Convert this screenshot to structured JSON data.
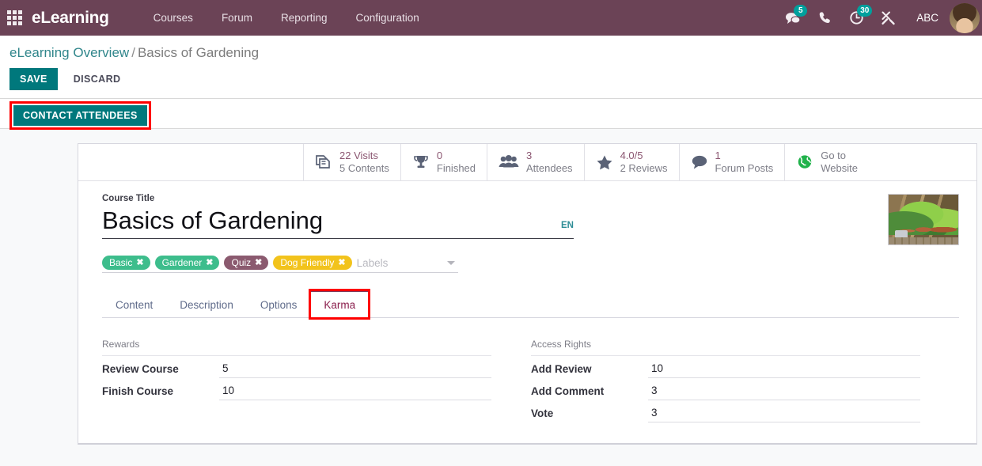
{
  "topbar": {
    "apps_icon": "apps-grid-icon",
    "brand": "eLearning",
    "menu": [
      {
        "label": "Courses"
      },
      {
        "label": "Forum"
      },
      {
        "label": "Reporting"
      },
      {
        "label": "Configuration"
      }
    ],
    "systray": [
      {
        "icon": "messages-icon",
        "badge": "5"
      },
      {
        "icon": "phone-icon",
        "badge": ""
      },
      {
        "icon": "activities-clock-icon",
        "badge": "30"
      },
      {
        "icon": "tools-icon",
        "badge": ""
      }
    ],
    "user_name": "ABC",
    "avatar": "user-avatar"
  },
  "breadcrumb": {
    "root": "eLearning Overview",
    "separator": "/",
    "current": "Basics of Gardening"
  },
  "actions": {
    "save_label": "SAVE",
    "discard_label": "DISCARD",
    "contact_attendees_label": "CONTACT ATTENDEES"
  },
  "stats": [
    {
      "icon": "documents-copy-icon",
      "value": "22 Visits",
      "label": "5 Contents",
      "value_style": "accent"
    },
    {
      "icon": "trophy-icon",
      "value": "0",
      "label": "Finished",
      "value_style": "accent"
    },
    {
      "icon": "attendees-people-icon",
      "value": "3",
      "label": "Attendees",
      "value_style": "accent"
    },
    {
      "icon": "star-icon",
      "value": "4.0/5",
      "label": "2 Reviews",
      "value_style": "accent"
    },
    {
      "icon": "comment-bubble-icon",
      "value": "1",
      "label": "Forum Posts",
      "value_style": "accent"
    },
    {
      "icon": "globe-icon",
      "value": "Go to",
      "label": "Website",
      "value_style": "plain"
    }
  ],
  "form": {
    "course_title_label": "Course Title",
    "course_title_value": "Basics of Gardening",
    "language_code": "EN",
    "thumbnail": "course-thumbnail-garden-plants",
    "tags": [
      {
        "name": "Basic",
        "color": "#3dbd8c"
      },
      {
        "name": "Gardener",
        "color": "#3dbd8c"
      },
      {
        "name": "Quiz",
        "color": "#8b5a6f"
      },
      {
        "name": "Dog Friendly",
        "color": "#f2c31c"
      }
    ],
    "tags_placeholder": "Labels",
    "tag_remove_glyph": "✖"
  },
  "tabs": [
    {
      "label": "Content",
      "active": false
    },
    {
      "label": "Description",
      "active": false
    },
    {
      "label": "Options",
      "active": false
    },
    {
      "label": "Karma",
      "active": true
    }
  ],
  "karma": {
    "rewards": {
      "title": "Rewards",
      "fields": [
        {
          "label": "Review Course",
          "value": "5"
        },
        {
          "label": "Finish Course",
          "value": "10"
        }
      ]
    },
    "access_rights": {
      "title": "Access Rights",
      "fields": [
        {
          "label": "Add Review",
          "value": "10"
        },
        {
          "label": "Add Comment",
          "value": "3"
        },
        {
          "label": "Vote",
          "value": "3"
        }
      ]
    }
  },
  "colors": {
    "navbar": "#6b4356",
    "primary": "#00787c",
    "badge": "#00a09d",
    "link": "#30868b",
    "annotation": "#ff0000",
    "active_tab_text": "#8b1f4d"
  }
}
